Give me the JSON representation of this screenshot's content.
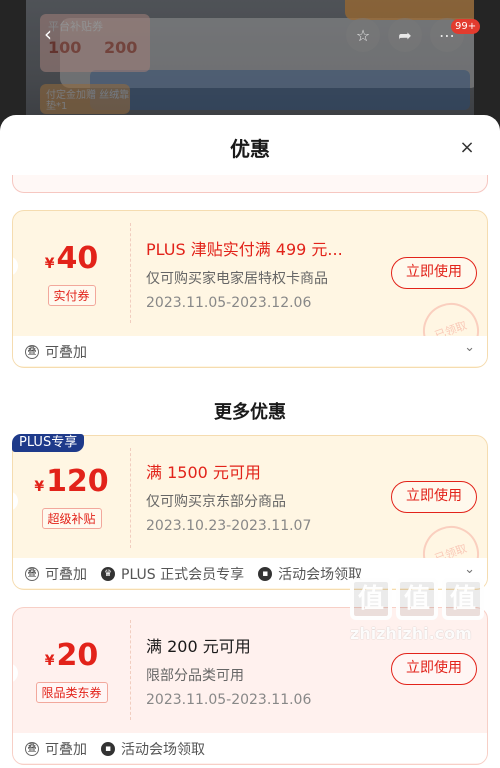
{
  "backdrop": {
    "coupon_title": "平台补贴券",
    "coupon_a": "100",
    "coupon_b": "200",
    "tag_text": "付定金加赠 丝绒靠垫*1",
    "notification_count": "99+"
  },
  "sheet": {
    "title": "优惠",
    "close_label": "×"
  },
  "coupons": [
    {
      "currency": "¥",
      "amount": "40",
      "tag": "实付券",
      "title": "PLUS 津贴实付满 499 元...",
      "scope": "仅可购买家电家居特权卡商品",
      "validity": "2023.11.05-2023.12.06",
      "button": "立即使用",
      "stamp": "已领取",
      "tags": [
        "可叠加"
      ]
    },
    {
      "badge": "PLUS专享",
      "currency": "¥",
      "amount": "120",
      "tag": "超级补贴",
      "title": "满 1500 元可用",
      "scope": "仅可购买京东部分商品",
      "validity": "2023.10.23-2023.11.07",
      "button": "立即使用",
      "stamp": "已领取",
      "tags": [
        "可叠加",
        "PLUS 正式会员专享",
        "活动会场领取"
      ]
    },
    {
      "currency": "¥",
      "amount": "20",
      "tag": "限品类东券",
      "title": "满 200 元可用",
      "scope": "限部分品类可用",
      "validity": "2023.11.05-2023.11.06",
      "button": "立即使用",
      "tags": [
        "可叠加",
        "活动会场领取"
      ]
    }
  ],
  "more_title": "更多优惠",
  "watermark": {
    "chars": [
      "值",
      "值",
      "值"
    ],
    "url": "zhizhizhi.com"
  },
  "colors": {
    "accent": "#e2231a",
    "card_gold_bg": "#fff6e3",
    "card_pink_bg": "#fff1ee"
  }
}
